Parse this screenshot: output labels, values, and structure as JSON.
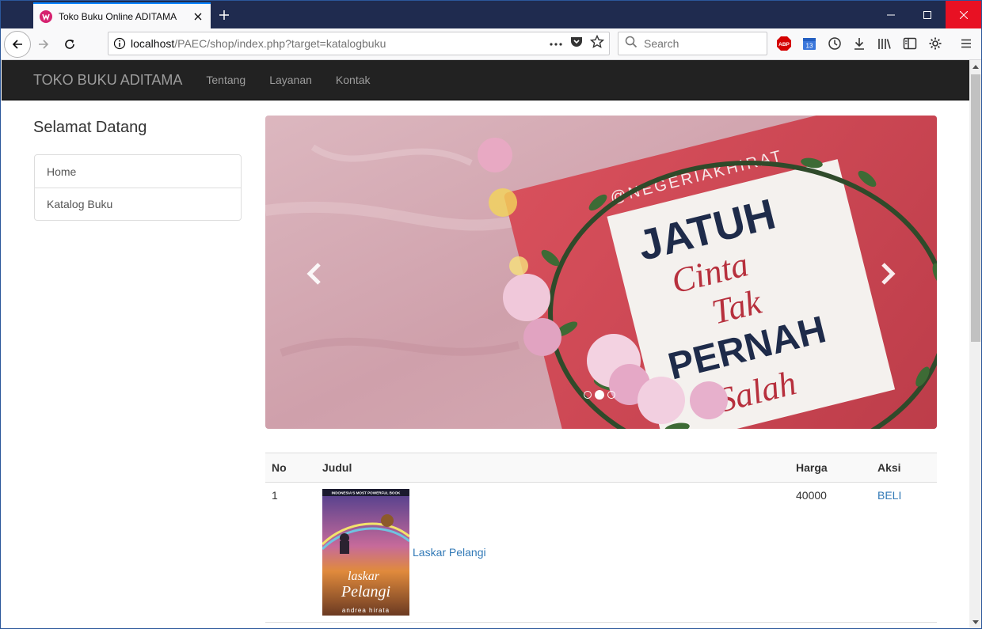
{
  "browser": {
    "tab_title": "Toko Buku Online ADITAMA",
    "url_host": "localhost",
    "url_path": "/PAEC/shop/index.php?target=katalogbuku",
    "search_placeholder": "Search",
    "calendar_badge": "13",
    "abp_label": "ABP"
  },
  "navbar": {
    "brand": "TOKO BUKU ADITAMA",
    "links": [
      "Tentang",
      "Layanan",
      "Kontak"
    ]
  },
  "sidebar": {
    "heading": "Selamat Datang",
    "items": [
      "Home",
      "Katalog Buku"
    ]
  },
  "carousel": {
    "slide_count": 3,
    "active_index": 1,
    "book_handle": "@NEGERIAKHIRAT",
    "book_title_line1": "JATUH",
    "book_title_line2": "Cinta",
    "book_title_line3": "Tak",
    "book_title_line4": "PERNAH",
    "book_title_line5": "Salah"
  },
  "table": {
    "headers": [
      "No",
      "Judul",
      "Harga",
      "Aksi"
    ],
    "rows": [
      {
        "no": "1",
        "cover": {
          "tagline": "INDONESIA'S MOST POWERFUL BOOK",
          "title_line1": "laskar",
          "title_line2": "Pelangi",
          "author": "andrea hirata"
        },
        "judul": "Laskar Pelangi",
        "harga": "40000",
        "aksi": "BELI"
      }
    ]
  },
  "colors": {
    "navbar_bg": "#222222",
    "link": "#337ab7",
    "titlebar": "#1f2b4f",
    "close_red": "#e81123"
  }
}
